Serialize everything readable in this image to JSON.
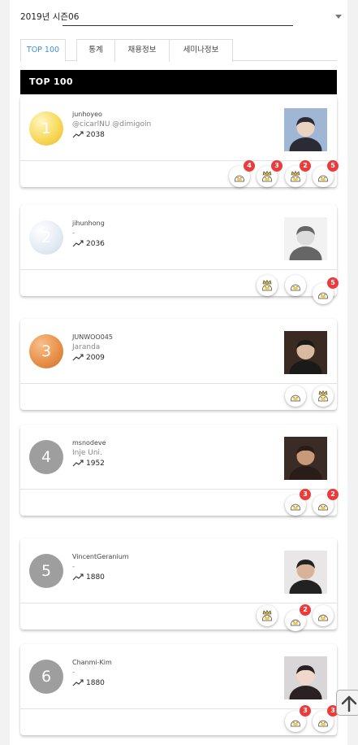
{
  "season": {
    "label": "2019년 시즌06"
  },
  "tabs": [
    {
      "label": "TOP 100",
      "active": true
    },
    {
      "label": "통계"
    },
    {
      "label": "채용정보"
    },
    {
      "label": "세미나정보"
    }
  ],
  "banner": {
    "title": "TOP 100"
  },
  "rankings": [
    {
      "rank": "1",
      "username": "junhoyeo",
      "org": "@cicarlNU @dimigoin",
      "score": "2038",
      "badges": [
        "4",
        "3",
        "2",
        "5"
      ]
    },
    {
      "rank": "2",
      "username": "jihunhong",
      "org": "-",
      "score": "2036",
      "badges": [
        "",
        "",
        "5"
      ]
    },
    {
      "rank": "3",
      "username": "JUNWOO045",
      "org": "Jaranda",
      "score": "2009",
      "badges": [
        "",
        ""
      ]
    },
    {
      "rank": "4",
      "username": "msnodeve",
      "org": "Inje Uni.",
      "score": "1952",
      "badges": [
        "3",
        "2"
      ]
    },
    {
      "rank": "5",
      "username": "VincentGeranium",
      "org": "-",
      "score": "1880",
      "badges": [
        "",
        "2",
        ""
      ]
    },
    {
      "rank": "6",
      "username": "Chanmi-Kim",
      "org": "-",
      "score": "1880",
      "badges": [
        "3",
        "3"
      ]
    }
  ],
  "colors": {
    "gold": "#f4c430",
    "silver": "#dbe3ee",
    "bronze": "#e08a3e",
    "grey": "#9e9e9e",
    "accent": "#3d8fe0",
    "count": "#ec3b3b"
  },
  "icons": {
    "score": "trending-up-icon",
    "scroll_top": "arrow-up-icon"
  }
}
